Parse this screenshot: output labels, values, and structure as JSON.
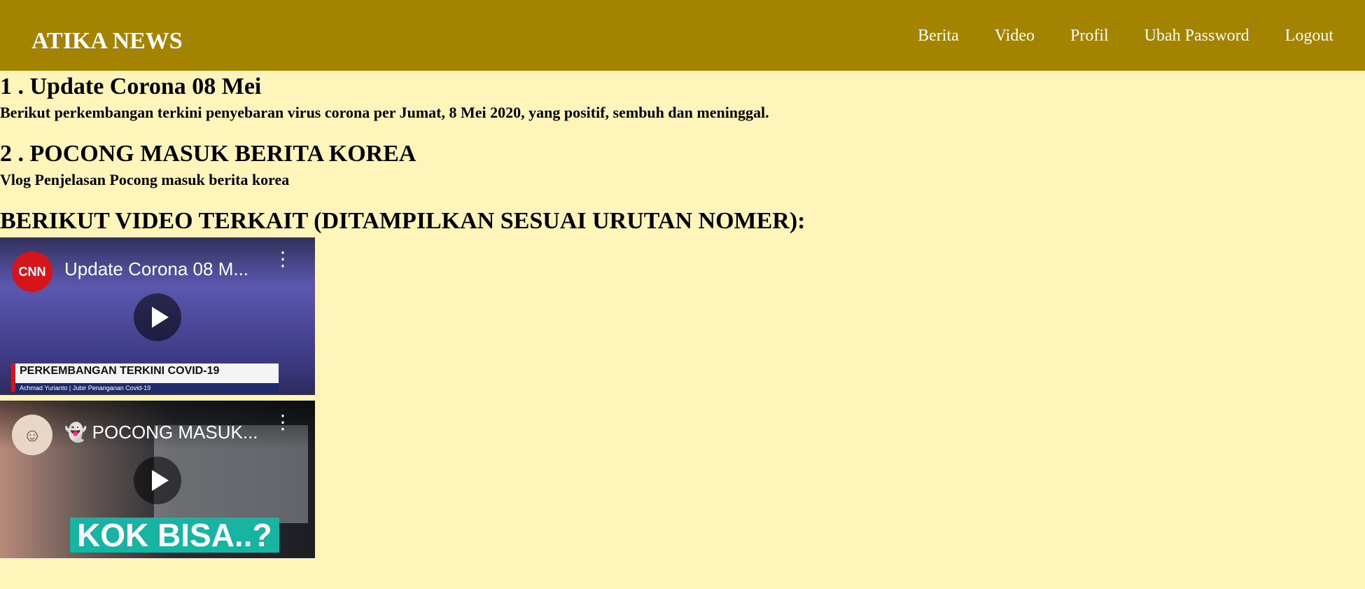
{
  "header": {
    "brand": "ATIKA NEWS",
    "nav": [
      "Berita",
      "Video",
      "Profil",
      "Ubah Password",
      "Logout"
    ]
  },
  "news": [
    {
      "title": "1 . Update Corona 08 Mei",
      "description": "Berikut perkembangan terkini penyebaran virus corona per Jumat, 8 Mei 2020, yang positif, sembuh dan meninggal."
    },
    {
      "title": "2 . POCONG MASUK BERITA KOREA",
      "description": "Vlog Penjelasan Pocong masuk berita korea"
    }
  ],
  "video_section_heading": "BERIKUT VIDEO TERKAIT (DITAMPILKAN SESUAI URUTAN NOMER):",
  "videos": [
    {
      "title": "Update Corona 08 M...",
      "channel_logo_text": "CNN",
      "overlay_title": "PERKEMBANGAN TERKINI COVID-19",
      "overlay_subtitle": "Achmad Yurianto | Jubir Penanganan Covid-19"
    },
    {
      "title": "👻 POCONG MASUK...",
      "channel_logo_text": "☺",
      "overlay_title": "KOK BISA..?"
    }
  ],
  "colors": {
    "navbar": "#A38300",
    "background": "#FFF5BB",
    "nav_text": "#FFFFFF"
  }
}
